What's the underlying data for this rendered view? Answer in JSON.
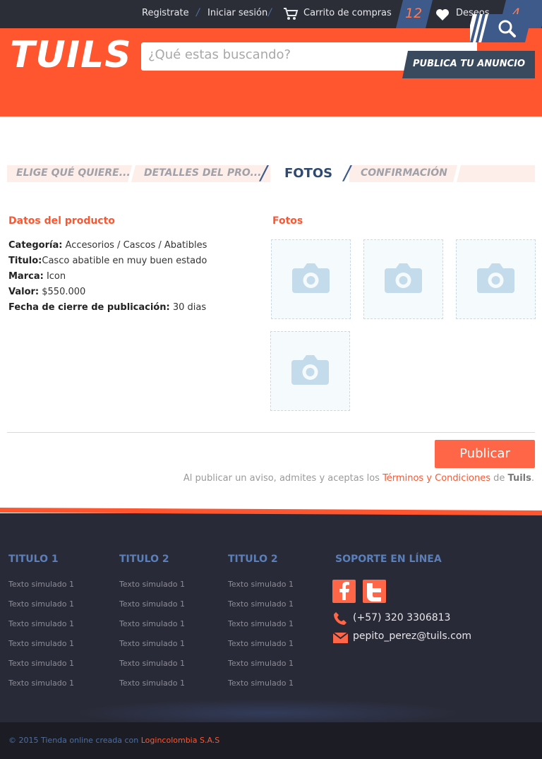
{
  "topbar": {
    "register": "Registrate",
    "login": "Iniciar sesión",
    "cart_label": "Carrito de compras",
    "cart_count": "12",
    "wishlist_label": "Deseos",
    "wishlist_count": "4"
  },
  "header": {
    "logo": "TUILS",
    "search_placeholder": "¿Qué estas buscando?",
    "publish_ad": "PUBLICA TU ANUNCIO"
  },
  "steps": {
    "step1": "ELIGE QUÉ QUIERE...",
    "step2": "DETALLES DEL PRO...",
    "step3": "FOTOS",
    "step4": "CONFIRMACIÓN"
  },
  "product": {
    "title": "Datos del producto",
    "category_label": "Categoría:",
    "category_value": " Accesorios / Cascos / Abatibles",
    "titulo_label": "Titulo:",
    "titulo_value": "Casco abatible en muy buen estado",
    "marca_label": "Marca:",
    "marca_value": "Icon",
    "valor_label": "Valor:",
    "valor_value": "$550.000",
    "fecha_label": "Fecha de cierre de publicación:",
    "fecha_value": "30 dias"
  },
  "photos": {
    "title": "Fotos"
  },
  "actions": {
    "publish": "Publicar",
    "terms_prefix": "Al publicar un aviso, admites y aceptas los ",
    "terms_link": "Términos y Condiciones",
    "terms_mid": " de ",
    "terms_brand": "Tuils",
    "terms_end": "."
  },
  "footer": {
    "col1_title": "TITULO 1",
    "col2_title": "TITULO 2",
    "col3_title": "TITULO 2",
    "support_title": "SOPORTE EN LÍNEA",
    "item_text": "Texto simulado 1",
    "phone": "(+57) 320 3306813",
    "email": "pepito_perez@tuils.com",
    "copyright_prefix": "© 2015 Tienda online creada con ",
    "copyright_link": "Logincolombia S.A.S"
  },
  "colors": {
    "brand_orange": "#ff5630",
    "navy": "#3d5a8a",
    "dark": "#292a37"
  }
}
